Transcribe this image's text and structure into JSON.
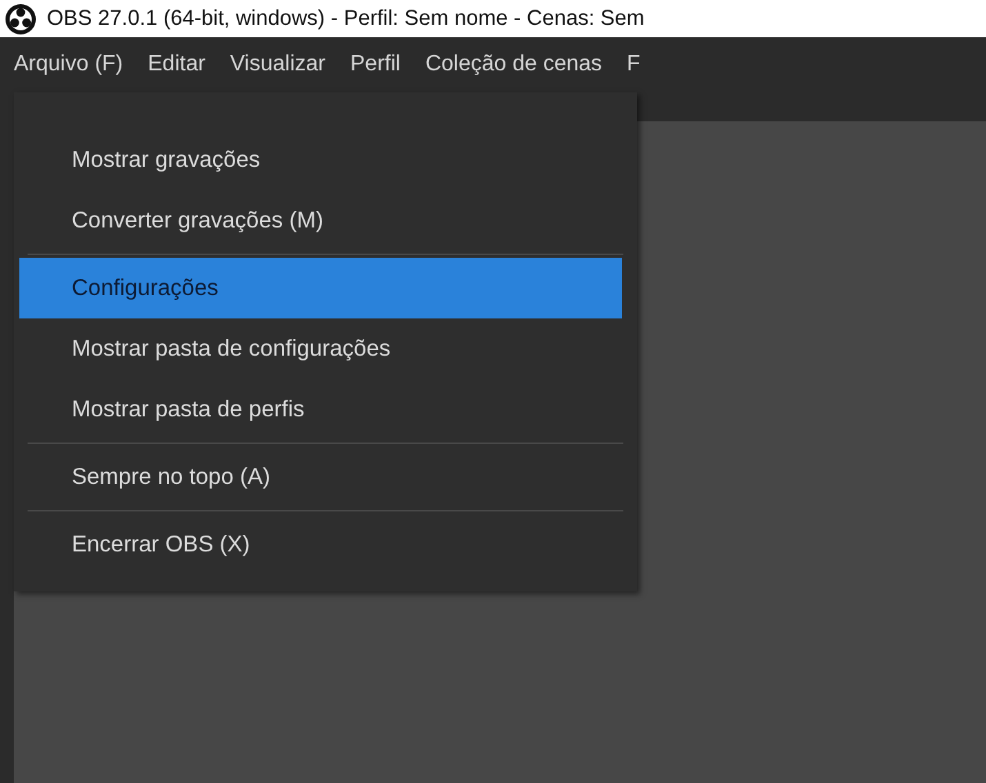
{
  "window": {
    "title": "OBS 27.0.1 (64-bit, windows) - Perfil: Sem nome - Cenas: Sem"
  },
  "menubar": [
    {
      "label": "Arquivo (F)",
      "selected": false
    },
    {
      "label": "Editar",
      "selected": false
    },
    {
      "label": "Visualizar",
      "selected": false
    },
    {
      "label": "Perfil",
      "selected": false
    },
    {
      "label": "Coleção de cenas",
      "selected": false
    },
    {
      "label": "F",
      "selected": false
    }
  ],
  "menu": [
    {
      "kind": "item",
      "label": "Mostrar gravações",
      "selected": false
    },
    {
      "kind": "item",
      "label": "Converter gravações (M)",
      "selected": false
    },
    {
      "kind": "separator"
    },
    {
      "kind": "item",
      "label": "Configurações",
      "selected": true
    },
    {
      "kind": "item",
      "label": "Mostrar pasta de configurações",
      "selected": false
    },
    {
      "kind": "item",
      "label": "Mostrar pasta de perfis",
      "selected": false
    },
    {
      "kind": "separator"
    },
    {
      "kind": "item",
      "label": "Sempre no topo (A)",
      "selected": false
    },
    {
      "kind": "separator"
    },
    {
      "kind": "item",
      "label": "Encerrar OBS (X)",
      "selected": false
    }
  ]
}
